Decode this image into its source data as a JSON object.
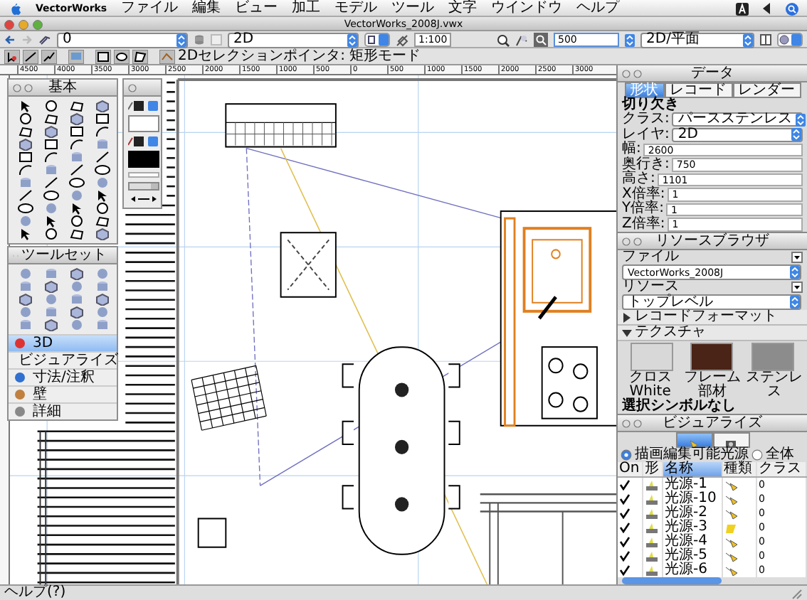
{
  "menubar": {
    "app": "VectorWorks",
    "items": [
      "ファイル",
      "編集",
      "ビュー",
      "加工",
      "モデル",
      "ツール",
      "文字",
      "ウインドウ",
      "ヘルプ"
    ]
  },
  "window": {
    "title": "VectorWorks_2008J.vwx"
  },
  "toolbar": {
    "class": "0",
    "layer": "2D",
    "scale": "1:100",
    "zoom": "500",
    "view": "2D/平面"
  },
  "mode_bar": {
    "text": "2Dセレクションポインタ: 矩形モード"
  },
  "ruler": {
    "labels": [
      "4500",
      "4000",
      "3500",
      "3000",
      "2500",
      "2000",
      "1500",
      "1000",
      "500",
      "0",
      "500",
      "1000",
      "1500",
      "2000",
      "2500",
      "3000"
    ]
  },
  "tool_palette": {
    "title": "基本"
  },
  "tool_sets": {
    "title": "ツールセット",
    "items": [
      {
        "label": "3D",
        "selected": true
      },
      {
        "label": "ビジュアライズ",
        "selected": false
      },
      {
        "label": "寸法/注釈",
        "selected": false
      },
      {
        "label": "壁",
        "selected": false
      },
      {
        "label": "詳細",
        "selected": false
      }
    ]
  },
  "data_palette": {
    "title": "データ",
    "tabs": [
      {
        "label": "形状",
        "selected": true
      },
      {
        "label": "レコード",
        "selected": false
      },
      {
        "label": "レンダー",
        "selected": false
      }
    ],
    "object_type": "切り欠き",
    "fields": [
      {
        "label": "クラス:",
        "value": "パースステンレス",
        "kind": "dropdown"
      },
      {
        "label": "レイヤ:",
        "value": "2D",
        "kind": "dropdown"
      },
      {
        "label": "幅:",
        "value": "2600",
        "kind": "text"
      },
      {
        "label": "奥行き:",
        "value": "750",
        "kind": "text"
      },
      {
        "label": "高さ:",
        "value": "1101",
        "kind": "text"
      },
      {
        "label": "X倍率:",
        "value": "1",
        "kind": "text"
      },
      {
        "label": "Y倍率:",
        "value": "1",
        "kind": "text"
      },
      {
        "label": "Z倍率:",
        "value": "1",
        "kind": "text"
      }
    ]
  },
  "resource_browser": {
    "title": "リソースブラウザ",
    "file_label": "ファイル",
    "file": "VectorWorks_2008J",
    "resource_label": "リソース",
    "folder": "トップレベル",
    "groups": [
      {
        "label": "レコードフォーマット",
        "expanded": false
      },
      {
        "label": "テクスチャ",
        "expanded": true
      }
    ],
    "textures": [
      {
        "name": "クロスWhite",
        "color": "#d8d8d8"
      },
      {
        "name": "フレーム部材",
        "color": "#4a2416"
      },
      {
        "name": "ステンレス",
        "color": "#8c8c8c"
      }
    ],
    "symbol": "選択シンボルなし"
  },
  "visualize": {
    "title": "ビジュアライズ",
    "tabs": [
      {
        "kind": "light",
        "selected": true
      },
      {
        "kind": "camera",
        "selected": false
      }
    ],
    "options": [
      {
        "label": "描画編集可能光源",
        "selected": true
      },
      {
        "label": "全体",
        "selected": false
      }
    ],
    "columns": [
      {
        "label": "On",
        "selected": false
      },
      {
        "label": "形",
        "selected": false
      },
      {
        "label": "名称",
        "selected": true
      },
      {
        "label": "種類",
        "selected": false
      },
      {
        "label": "クラス",
        "selected": false
      }
    ],
    "lights": [
      {
        "on": true,
        "name": "光源-1",
        "kind": "spot",
        "class": "0"
      },
      {
        "on": true,
        "name": "光源-10",
        "kind": "spot",
        "class": "0"
      },
      {
        "on": true,
        "name": "光源-2",
        "kind": "spot",
        "class": "0"
      },
      {
        "on": true,
        "name": "光源-3",
        "kind": "area",
        "class": "0"
      },
      {
        "on": true,
        "name": "光源-4",
        "kind": "spot",
        "class": "0"
      },
      {
        "on": true,
        "name": "光源-5",
        "kind": "spot",
        "class": "0"
      },
      {
        "on": true,
        "name": "光源-6",
        "kind": "spot",
        "class": "0"
      }
    ]
  },
  "status_bar": {
    "text": "ヘルプ(?)"
  }
}
